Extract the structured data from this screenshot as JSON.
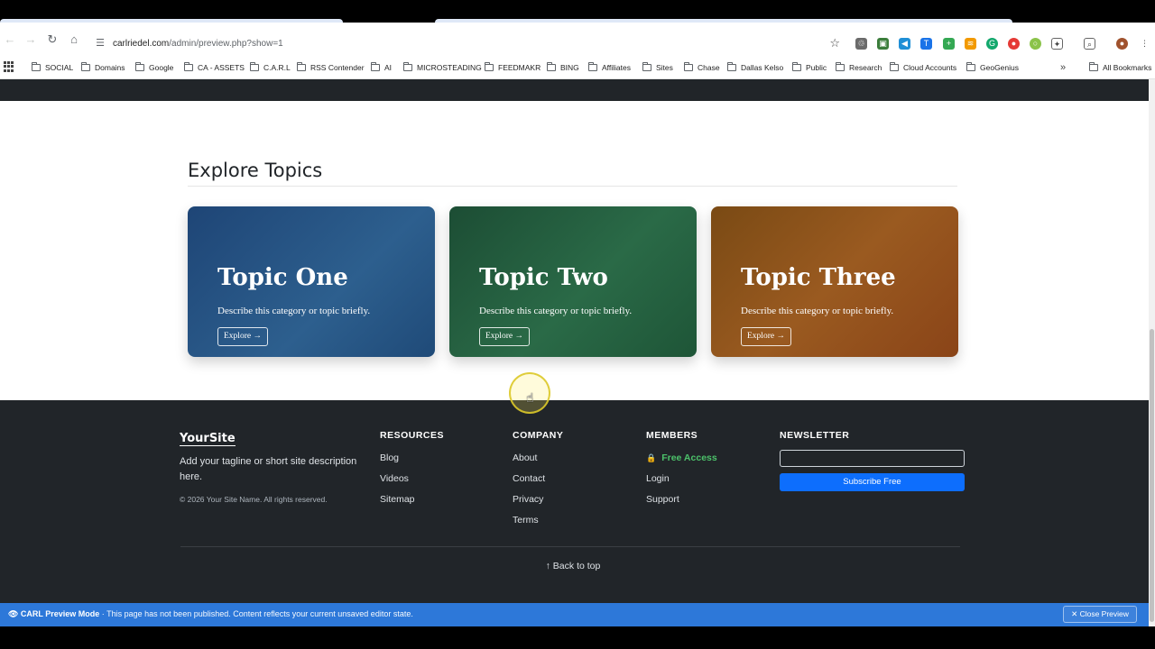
{
  "browser": {
    "url_host": "carlriedel.com",
    "url_path": "/admin/preview.php?show=1",
    "back_icon": "arrow-left-icon",
    "forward_icon": "arrow-right-icon",
    "reload_icon": "reload-icon",
    "home_icon": "home-icon"
  },
  "bookmarks": [
    "SOCIAL",
    "Domains",
    "Google",
    "CA - ASSETS",
    "C.A.R.L",
    "RSS Contender",
    "AI",
    "MICROSTEADING",
    "FEEDMAKR",
    "BING",
    "Affiliates",
    "Sites",
    "Chase",
    "Dallas Kelso",
    "Public",
    "Research",
    "Cloud Accounts",
    "GeoGenius"
  ],
  "all_bookmarks": "All Bookmarks",
  "topics": {
    "title": "Explore Topics",
    "cards": [
      {
        "title": "Topic One",
        "desc": "Describe this category or topic briefly.",
        "button": "Explore →",
        "color": "#1e4576"
      },
      {
        "title": "Topic Two",
        "desc": "Describe this category or topic briefly.",
        "button": "Explore →",
        "color": "#1c4d34"
      },
      {
        "title": "Topic Three",
        "desc": "Describe this category or topic briefly.",
        "button": "Explore →",
        "color": "#8a4a18"
      }
    ]
  },
  "footer": {
    "brand": "YourSite",
    "tagline": "Add your tagline or short site description here.",
    "copyright": "© 2026 Your Site Name. All rights reserved.",
    "resources": {
      "heading": "RESOURCES",
      "links": [
        "Blog",
        "Videos",
        "Sitemap"
      ]
    },
    "company": {
      "heading": "COMPANY",
      "links": [
        "About",
        "Contact",
        "Privacy",
        "Terms"
      ]
    },
    "members": {
      "heading": "MEMBERS",
      "links": [
        "Free Access",
        "Login",
        "Support"
      ]
    },
    "newsletter": {
      "heading": "NEWSLETTER",
      "button": "Subscribe Free",
      "placeholder": ""
    },
    "back_to_top": "↑ Back to top"
  },
  "preview_bar": {
    "label": "👁 CARL Preview Mode",
    "message": "· This page has not been published. Content reflects your current unsaved editor state.",
    "close": "✕ Close Preview"
  },
  "colors": {
    "accent_blue": "#0d6efd",
    "footer_bg": "#212529",
    "preview_bar": "#2d78d9",
    "member_green": "#4cc26a"
  }
}
